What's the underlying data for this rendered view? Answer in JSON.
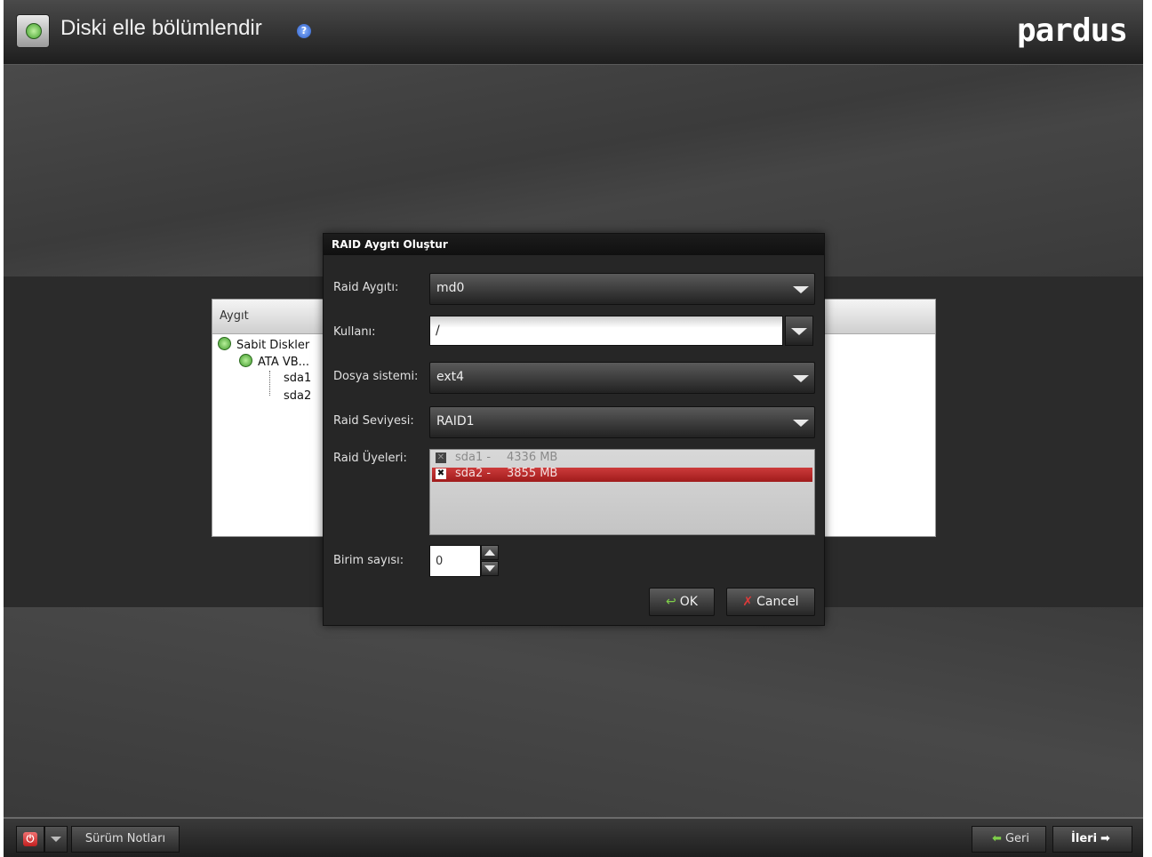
{
  "header": {
    "title": "Diski elle bölümlendir",
    "help_icon": "?",
    "brand": "pardus",
    "app_icon": "disk-icon"
  },
  "device_panel": {
    "column_header": "Aygıt",
    "tree": {
      "root": "Sabit Diskler",
      "disk": "ATA VB...",
      "partitions": [
        "sda1",
        "sda2"
      ]
    }
  },
  "dialog": {
    "title": "RAID Aygıtı Oluştur",
    "raid_device": {
      "label": "Raid Aygıtı:",
      "value": "md0"
    },
    "mount_point": {
      "label": "Kullanı:",
      "value": "/"
    },
    "filesystem": {
      "label": "Dosya sistemi:",
      "value": "ext4"
    },
    "raid_level": {
      "label": "Raid Seviyesi:",
      "value": "RAID1"
    },
    "raid_members": {
      "label": "Raid Üyeleri:",
      "items": [
        {
          "name": "sda1 -",
          "size": "4336 MB",
          "checked": false,
          "selected": false
        },
        {
          "name": "sda2 -",
          "size": "3855 MB",
          "checked": true,
          "selected": true
        }
      ]
    },
    "spare_count": {
      "label": "Birim sayısı:",
      "value": "0"
    },
    "ok_label": "OK",
    "cancel_label": "Cancel"
  },
  "footer": {
    "release_notes": "Sürüm Notları",
    "back": "Geri",
    "next": "İleri"
  },
  "colors": {
    "selection": "#b82828",
    "background": "#3a3a3a",
    "dialog": "#262626"
  }
}
